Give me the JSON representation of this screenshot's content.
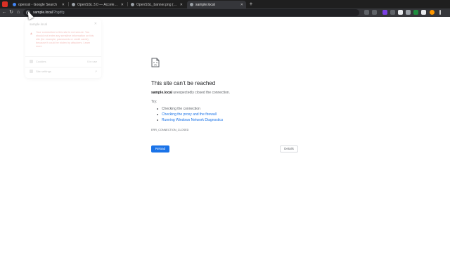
{
  "tabs": [
    {
      "title": "openssl - Google Search",
      "favicon_color": "#4285f4",
      "active": false
    },
    {
      "title": "OpenSSL 3.0 — Accelerating fo…",
      "favicon_color": "#9aa0a6",
      "active": false
    },
    {
      "title": "OpenSSL_banner.png (555×200)",
      "favicon_color": "#9aa0a6",
      "active": false
    },
    {
      "title": "sample.local",
      "favicon_color": "#9aa0a6",
      "active": true
    }
  ],
  "address_bar": {
    "host": "sample.local",
    "path": "/?bgdfg"
  },
  "site_info_popup": {
    "title": "sample.local",
    "message": "Your connection to this site is not secure. You should not enter any sensitive information on this site (for example, passwords or credit cards), because it could be stolen by attackers. Learn more",
    "cookies_label": "Cookies",
    "cookies_value": "0 in use",
    "settings_label": "Site settings"
  },
  "error_page": {
    "headline": "This site can’t be reached",
    "host": "sample.local",
    "description_suffix": " unexpectedly closed the connection.",
    "try_label": "Try:",
    "suggestions": [
      "Checking the connection",
      "Checking the proxy and the firewall",
      "Running Windows Network Diagnostics"
    ],
    "error_code": "ERR_CONNECTION_CLOSED",
    "reload_label": "Reload",
    "details_label": "Details"
  },
  "colors": {
    "accent": "#1a73e8",
    "link": "#1a73e8",
    "warning": "#d93025"
  }
}
